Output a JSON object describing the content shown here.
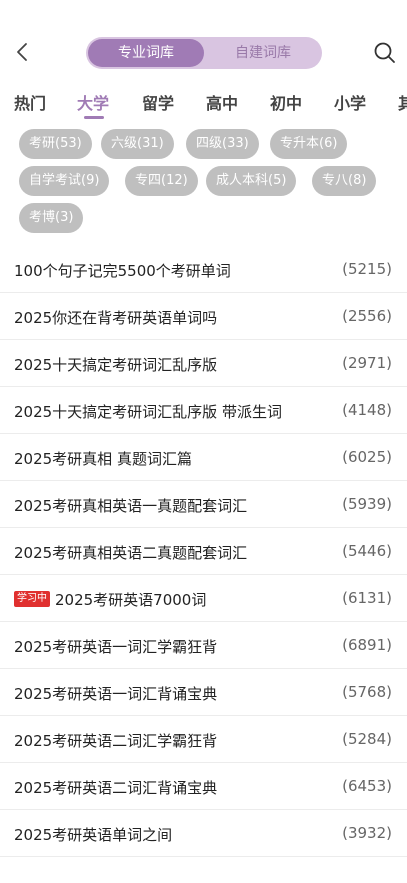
{
  "header": {
    "tab_professional": "专业词库",
    "tab_custom": "自建词库"
  },
  "categories": [
    "热门",
    "大学",
    "留学",
    "高中",
    "初中",
    "小学",
    "其"
  ],
  "active_category": "大学",
  "chips": [
    "考研(53)",
    "六级(31)",
    "四级(33)",
    "专升本(6)",
    "自学考试(9)",
    "专四(12)",
    "成人本科(5)",
    "专八(8)",
    "考博(3)"
  ],
  "books": [
    {
      "title": "100个句子记完5500个考研单词",
      "count": "(5215)"
    },
    {
      "title": "2025你还在背考研英语单词吗",
      "count": "(2556)"
    },
    {
      "title": "2025十天搞定考研词汇乱序版",
      "count": "(2971)"
    },
    {
      "title": "2025十天搞定考研词汇乱序版 带派生词",
      "count": "(4148)"
    },
    {
      "title": "2025考研真相 真题词汇篇",
      "count": "(6025)"
    },
    {
      "title": "2025考研真相英语一真题配套词汇",
      "count": "(5939)"
    },
    {
      "title": "2025考研真相英语二真题配套词汇",
      "count": "(5446)"
    },
    {
      "title": "2025考研英语7000词",
      "count": "(6131)",
      "badge": "学习中"
    },
    {
      "title": "2025考研英语一词汇学霸狂背",
      "count": "(6891)"
    },
    {
      "title": "2025考研英语一词汇背诵宝典",
      "count": "(5768)"
    },
    {
      "title": "2025考研英语二词汇学霸狂背",
      "count": "(5284)"
    },
    {
      "title": "2025考研英语二词汇背诵宝典",
      "count": "(6453)"
    },
    {
      "title": "2025考研英语单词之间",
      "count": "(3932)"
    }
  ],
  "colors": {
    "accent": "#a07bb5",
    "segment_bg": "#d9c5e1",
    "chip_bg": "#bfbfbf",
    "badge_bg": "#e0302f"
  },
  "icons": {
    "back": "chevron-left-icon",
    "search": "search-icon"
  }
}
